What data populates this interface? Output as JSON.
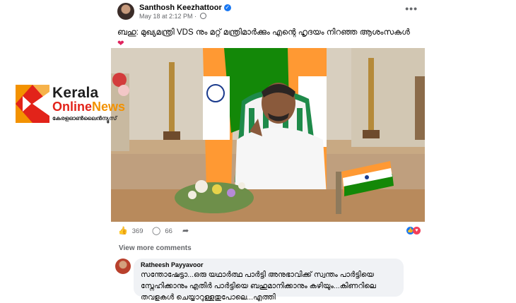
{
  "post": {
    "author": "Santhosh Keezhattoor",
    "timestamp": "May 18 at 2:12 PM",
    "more_icon": "•••",
    "caption": "ബഹു: മുഖ്യമന്ത്രി VDS നും മറ്റ് മന്ത്രിമാർക്കും എന്റെ ഹൃദയം നിറഞ്ഞ ആശംസകൾ",
    "caption_emoji": "❤",
    "like_count": "369",
    "comment_count": "66"
  },
  "comments": {
    "view_more_label": "View more comments",
    "items": [
      {
        "name": "Ratheesh Payyavoor",
        "text": "സന്തോഷേട്ടാ...ഒരു യഥാർത്ഥ പാർട്ടി അനുഭാവിക്ക് സ്വന്തം പാർട്ടിയെ സ്നേഹിക്കാനും എതിർ പാർട്ടിയെ ബഹുമാനിക്കാനും കഴിയും...കിണറിലെ തവളകൾ ചെയ്യാറുള്ളതുപോലെ...എത്തി"
      }
    ]
  },
  "watermark": {
    "line1": "Kerala",
    "line2a": "Online",
    "line2b": "News",
    "line3": "കേരളഓൺലൈൻന്യൂസ്"
  },
  "colors": {
    "facebook_blue": "#1877f2",
    "love_red": "#f33e58",
    "brand_red": "#e2231a",
    "brand_orange": "#f39200"
  },
  "icons": [
    "verified-badge-icon",
    "globe-icon",
    "more-options-icon",
    "like-icon",
    "comment-icon",
    "share-icon",
    "like-reaction-icon",
    "love-reaction-icon"
  ]
}
